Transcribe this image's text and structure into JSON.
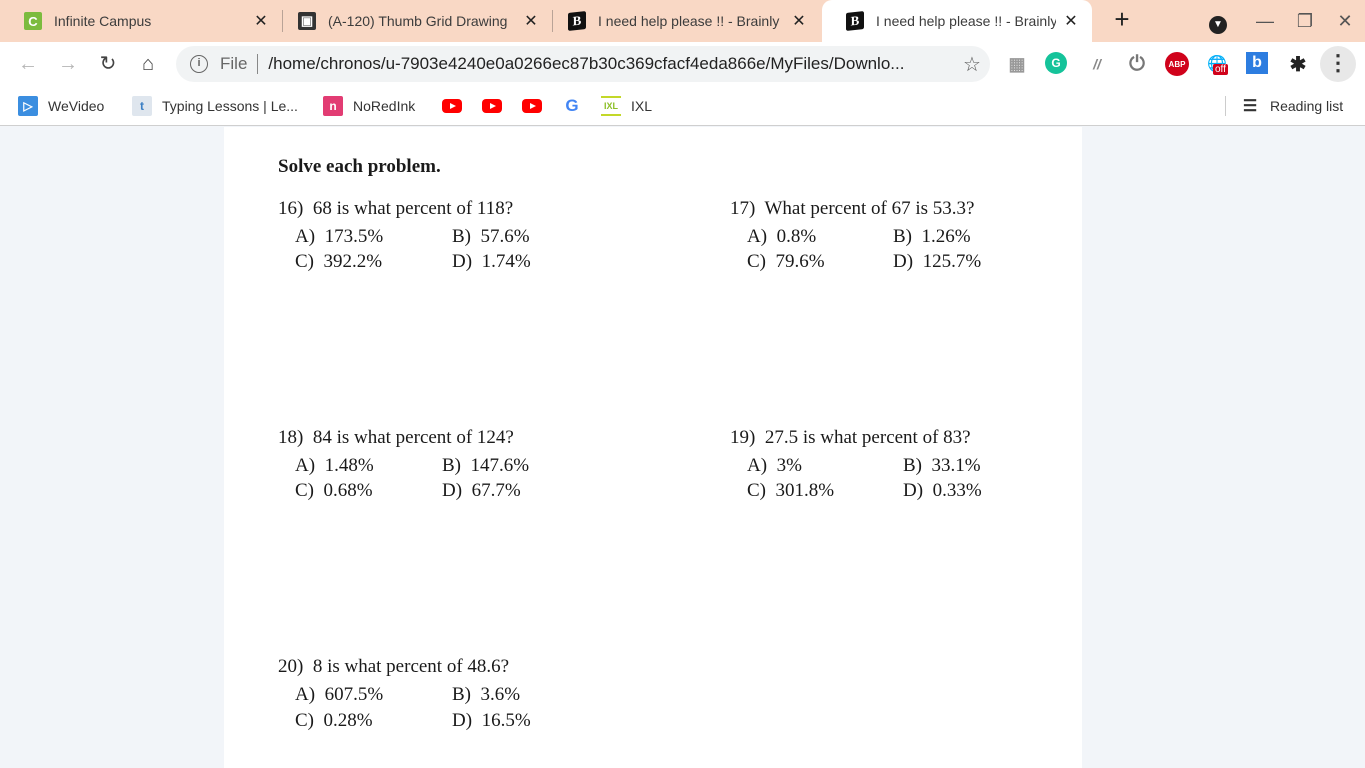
{
  "browser": {
    "tabs": [
      {
        "title": "Infinite Campus",
        "favicon": "infinite-campus-icon",
        "active": false
      },
      {
        "title": "(A-120) Thumb Grid Drawing",
        "favicon": "classroom-icon",
        "active": false
      },
      {
        "title": "I need help please !! - Brainly",
        "favicon": "brainly-icon",
        "active": false
      },
      {
        "title": "I need help please !! - Brainly",
        "favicon": "brainly-icon",
        "active": true
      }
    ],
    "tab_close_glyph": "✕",
    "new_tab_glyph": "+",
    "window_controls": {
      "minimize": "—",
      "restore": "❐",
      "close": "✕"
    },
    "toolbar": {
      "back_glyph": "←",
      "forward_glyph": "→",
      "reload_glyph": "↻",
      "home_glyph": "⌂",
      "omnibox": {
        "info_glyph": "i",
        "scheme_label": "File",
        "url": "/home/chronos/u-7903e4240e0a0266ec87b30c369cfacf4eda866e/MyFiles/Downlo...",
        "star_glyph": "☆"
      },
      "extensions": [
        {
          "name": "office-icon",
          "glyph": "▦"
        },
        {
          "name": "grammarly-icon",
          "glyph": "G"
        },
        {
          "name": "kami-icon",
          "glyph": "//"
        },
        {
          "name": "power-icon",
          "glyph": "⏻"
        },
        {
          "name": "adblock-plus-icon",
          "glyph": "ABP"
        },
        {
          "name": "translate-off-icon",
          "glyph": "🌐",
          "badge": "off"
        },
        {
          "name": "bing-icon",
          "glyph": "b"
        },
        {
          "name": "extensions-puzzle-icon",
          "glyph": "✱"
        }
      ],
      "menu_glyph": "⋮"
    },
    "bookmarks": [
      {
        "label": "WeVideo",
        "icon": "wevideo-icon"
      },
      {
        "label": "Typing Lessons | Le...",
        "icon": "typing-icon"
      },
      {
        "label": "NoRedInk",
        "icon": "noredink-icon"
      },
      {
        "label": "",
        "icon": "youtube-icon"
      },
      {
        "label": "",
        "icon": "youtube-icon"
      },
      {
        "label": "",
        "icon": "youtube-icon"
      },
      {
        "label": "",
        "icon": "google-icon"
      },
      {
        "label": "IXL",
        "icon": "ixl-icon"
      }
    ],
    "reading_list": "Reading list"
  },
  "document": {
    "heading": "Solve each problem.",
    "problems": [
      {
        "number": "16)",
        "question": "68 is what percent of 118?",
        "choices": [
          {
            "letter": "A)",
            "value": "173.5%"
          },
          {
            "letter": "B)",
            "value": "57.6%"
          },
          {
            "letter": "C)",
            "value": "392.2%"
          },
          {
            "letter": "D)",
            "value": "1.74%"
          }
        ]
      },
      {
        "number": "17)",
        "question": "What percent of 67 is 53.3?",
        "choices": [
          {
            "letter": "A)",
            "value": "0.8%"
          },
          {
            "letter": "B)",
            "value": "1.26%"
          },
          {
            "letter": "C)",
            "value": "79.6%"
          },
          {
            "letter": "D)",
            "value": "125.7%"
          }
        ]
      },
      {
        "number": "18)",
        "question": "84 is what percent of 124?",
        "choices": [
          {
            "letter": "A)",
            "value": "1.48%"
          },
          {
            "letter": "B)",
            "value": "147.6%"
          },
          {
            "letter": "C)",
            "value": "0.68%"
          },
          {
            "letter": "D)",
            "value": "67.7%"
          }
        ]
      },
      {
        "number": "19)",
        "question": "27.5 is what percent of 83?",
        "choices": [
          {
            "letter": "A)",
            "value": "3%"
          },
          {
            "letter": "B)",
            "value": "33.1%"
          },
          {
            "letter": "C)",
            "value": "301.8%"
          },
          {
            "letter": "D)",
            "value": "0.33%"
          }
        ]
      },
      {
        "number": "20)",
        "question": "8 is what percent of 48.6?",
        "choices": [
          {
            "letter": "A)",
            "value": "607.5%"
          },
          {
            "letter": "B)",
            "value": "3.6%"
          },
          {
            "letter": "C)",
            "value": "0.28%"
          },
          {
            "letter": "D)",
            "value": "16.5%"
          }
        ]
      }
    ]
  },
  "colors": {
    "tabstrip": "#f9d8c5",
    "active_tab": "#ffffff",
    "viewport_bg": "#f2f5f9",
    "page_bg": "#ffffff"
  }
}
